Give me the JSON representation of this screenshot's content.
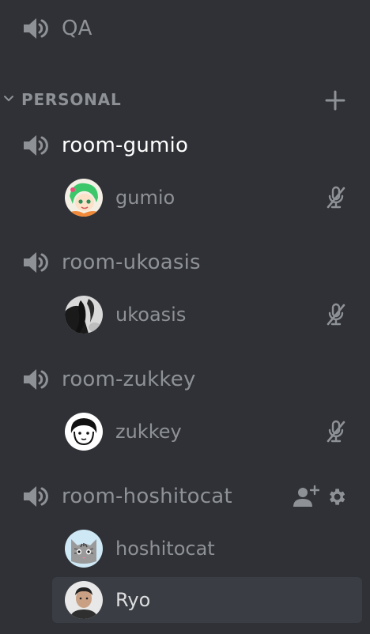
{
  "colors": {
    "background": "#2f3136",
    "text_muted": "#8e9297",
    "text_active": "#ffffff",
    "hover_row": "#3a3d43"
  },
  "channels": {
    "qa": {
      "label": "QA",
      "icon": "speaker-icon"
    },
    "room_gumio": {
      "label": "room-gumio",
      "icon": "speaker-icon",
      "active": true
    },
    "room_ukoasis": {
      "label": "room-ukoasis",
      "icon": "speaker-icon"
    },
    "room_zukkey": {
      "label": "room-zukkey",
      "icon": "speaker-icon"
    },
    "room_hoshitocat": {
      "label": "room-hoshitocat",
      "icon": "speaker-icon"
    }
  },
  "category": {
    "label": "PERSONAL",
    "collapse_icon": "chevron-down-icon",
    "add_icon": "plus-icon"
  },
  "members": {
    "gumio": {
      "name": "gumio",
      "muted": true
    },
    "ukoasis": {
      "name": "ukoasis",
      "muted": true
    },
    "zukkey": {
      "name": "zukkey",
      "muted": true
    },
    "hoshitocat": {
      "name": "hoshitocat",
      "muted": false
    },
    "ryo": {
      "name": "Ryo",
      "muted": false
    }
  },
  "channel_actions": {
    "invite_icon": "invite-member-icon",
    "settings_icon": "gear-icon"
  }
}
